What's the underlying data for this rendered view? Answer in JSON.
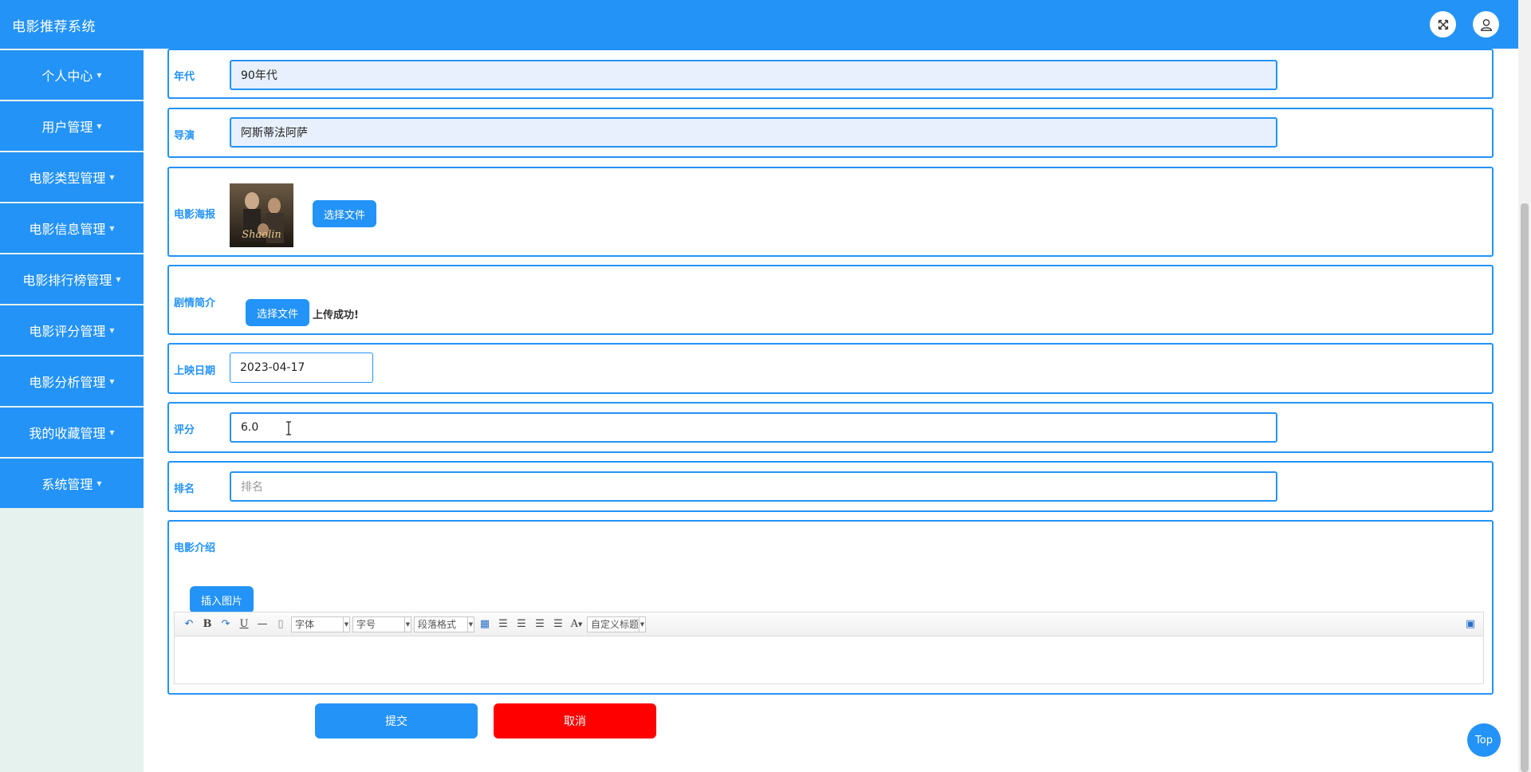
{
  "header": {
    "title": "电影推荐系统"
  },
  "sidebar": {
    "items": [
      {
        "label": "个人中心"
      },
      {
        "label": "用户管理"
      },
      {
        "label": "电影类型管理"
      },
      {
        "label": "电影信息管理"
      },
      {
        "label": "电影排行榜管理"
      },
      {
        "label": "电影评分管理"
      },
      {
        "label": "电影分析管理"
      },
      {
        "label": "我的收藏管理"
      },
      {
        "label": "系统管理"
      }
    ]
  },
  "form": {
    "era": {
      "label": "年代",
      "value": "90年代"
    },
    "director": {
      "label": "导演",
      "value": "阿斯蒂法阿萨"
    },
    "poster": {
      "label": "电影海报",
      "button": "选择文件",
      "image_text": "Shaolin"
    },
    "synopsis": {
      "label": "剧情简介",
      "button": "选择文件",
      "status": "上传成功!"
    },
    "release_date": {
      "label": "上映日期",
      "value": "2023-04-17"
    },
    "rating": {
      "label": "评分",
      "value": "6.0"
    },
    "rank": {
      "label": "排名",
      "placeholder": "排名"
    },
    "intro": {
      "label": "电影介绍",
      "insert_image": "插入图片",
      "toolbar": {
        "font": "字体",
        "size": "字号",
        "paragraph": "段落格式",
        "custom_title": "自定义标题"
      }
    },
    "submit": "提交",
    "cancel": "取消"
  },
  "top_button": "Top"
}
